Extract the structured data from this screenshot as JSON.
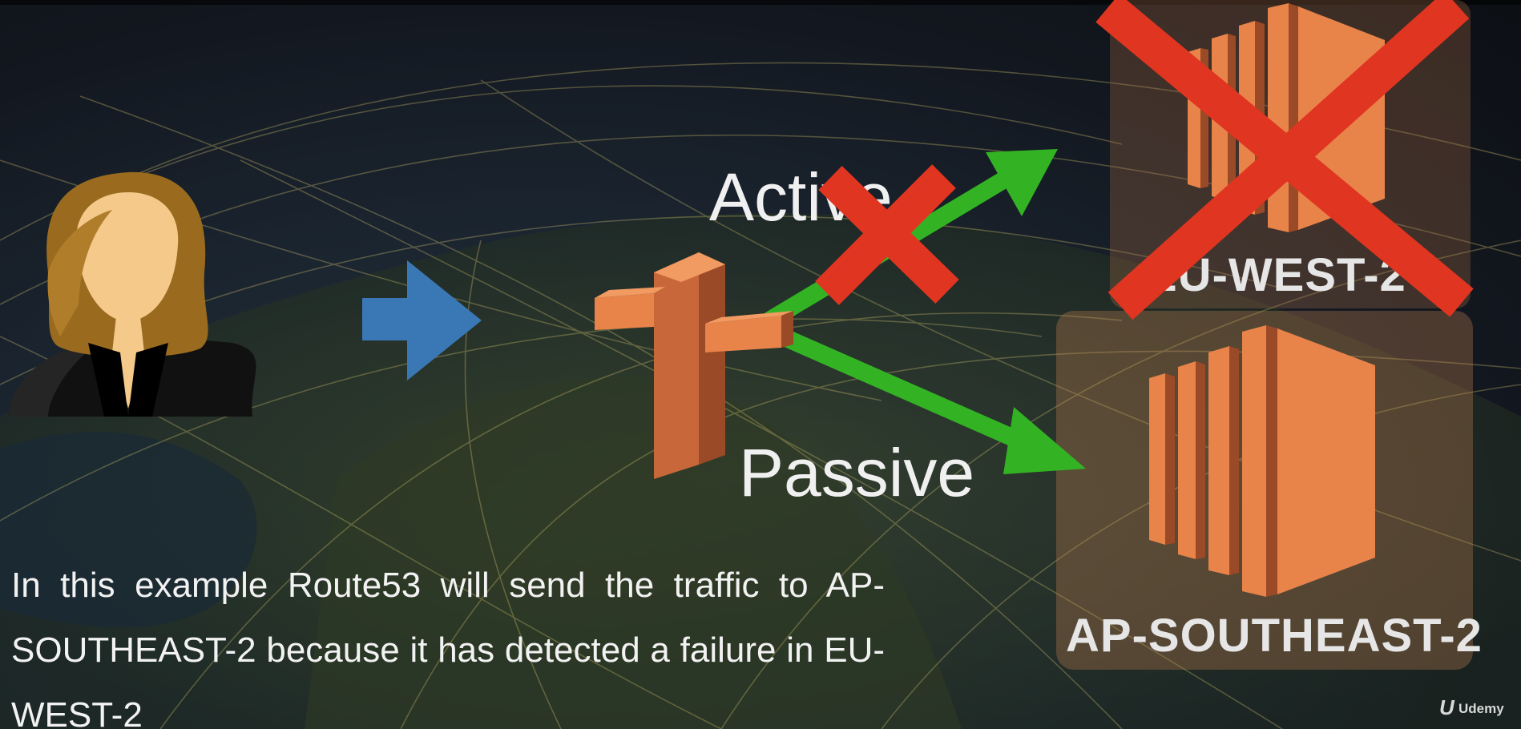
{
  "diagram": {
    "labels": {
      "active": "Active",
      "passive": "Passive"
    },
    "regions": {
      "primary": "EU-WEST-2",
      "secondary": "AP-SOUTHEAST-2"
    },
    "caption": "In this example Route53 will send the traffic to AP-SOUTHEAST-2 because it has detected a failure in EU-WEST-2",
    "brand": "Udemy",
    "brand_logo": "U",
    "icons": [
      "user-avatar-icon",
      "arrow-right-icon",
      "route53-icon",
      "ec2-server-icon",
      "failure-x-icon"
    ],
    "colors": {
      "arrow_blue": "#3a78b5",
      "arrow_green": "#33b324",
      "failure_red": "#e03520",
      "aws_orange": "#e8834a"
    }
  }
}
